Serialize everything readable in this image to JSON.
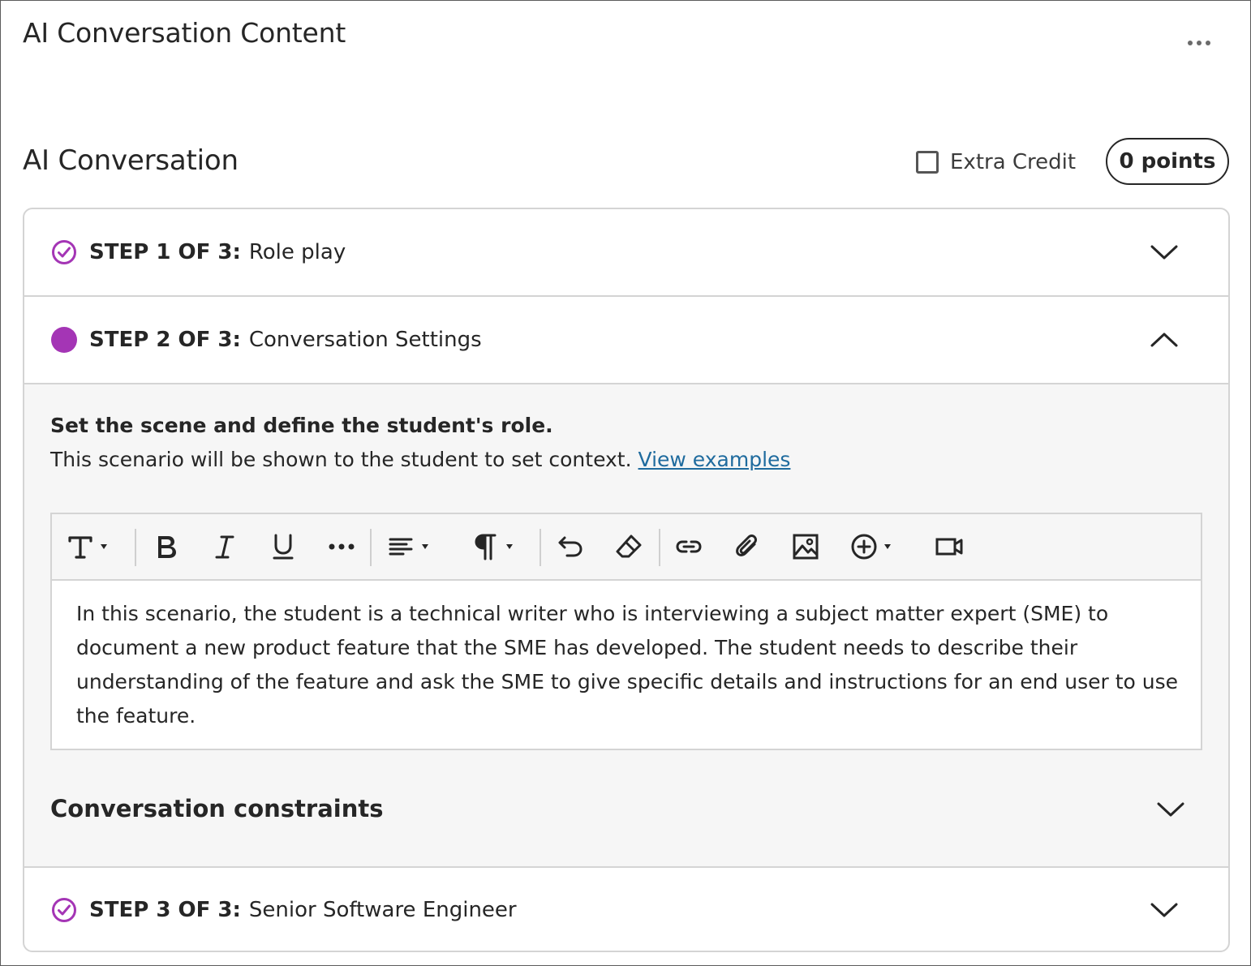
{
  "panel": {
    "title": "AI Conversation Content",
    "more_icon": "more-horizontal-icon"
  },
  "section": {
    "title": "AI Conversation",
    "extra_credit_label": "Extra Credit",
    "extra_credit_checked": false,
    "points_label": "0 points"
  },
  "colors": {
    "accent": "#a435b5",
    "link": "#1f6b9e",
    "text": "#262626",
    "body_bg": "#f6f6f6",
    "border": "#d4d4d4"
  },
  "steps": [
    {
      "prefix": "STEP 1 OF 3:",
      "name": "Role play",
      "status": "complete",
      "status_icon": "check-circle-icon",
      "expanded": false
    },
    {
      "prefix": "STEP 2 OF 3:",
      "name": "Conversation Settings",
      "status": "current",
      "status_icon": "filled-circle-icon",
      "expanded": true
    },
    {
      "prefix": "STEP 3 OF 3:",
      "name": "Senior Software Engineer",
      "status": "complete",
      "status_icon": "check-circle-icon",
      "expanded": false
    }
  ],
  "step2": {
    "heading": "Set the scene and define the student's role.",
    "description": "This scenario will be shown to the student to set context.",
    "link_label": "View examples",
    "editor": {
      "toolbar": [
        {
          "icon": "text-style-icon",
          "dropdown": true
        },
        {
          "icon": "bold-icon"
        },
        {
          "icon": "italic-icon"
        },
        {
          "icon": "underline-icon"
        },
        {
          "icon": "more-formatting-icon"
        },
        {
          "icon": "align-left-icon",
          "dropdown": true
        },
        {
          "icon": "paragraph-icon",
          "dropdown": true
        },
        {
          "icon": "undo-icon"
        },
        {
          "icon": "eraser-icon"
        },
        {
          "icon": "link-icon"
        },
        {
          "icon": "attachment-icon"
        },
        {
          "icon": "image-icon"
        },
        {
          "icon": "insert-plus-icon",
          "dropdown": true
        },
        {
          "icon": "video-icon"
        }
      ],
      "content": "In this scenario, the student is a technical writer who is interviewing a subject matter expert (SME) to document a new product feature that the SME has developed. The student needs to describe their understanding of the feature and ask the SME to give specific details and instructions for an end user to use the feature."
    },
    "constraints_label": "Conversation constraints"
  }
}
